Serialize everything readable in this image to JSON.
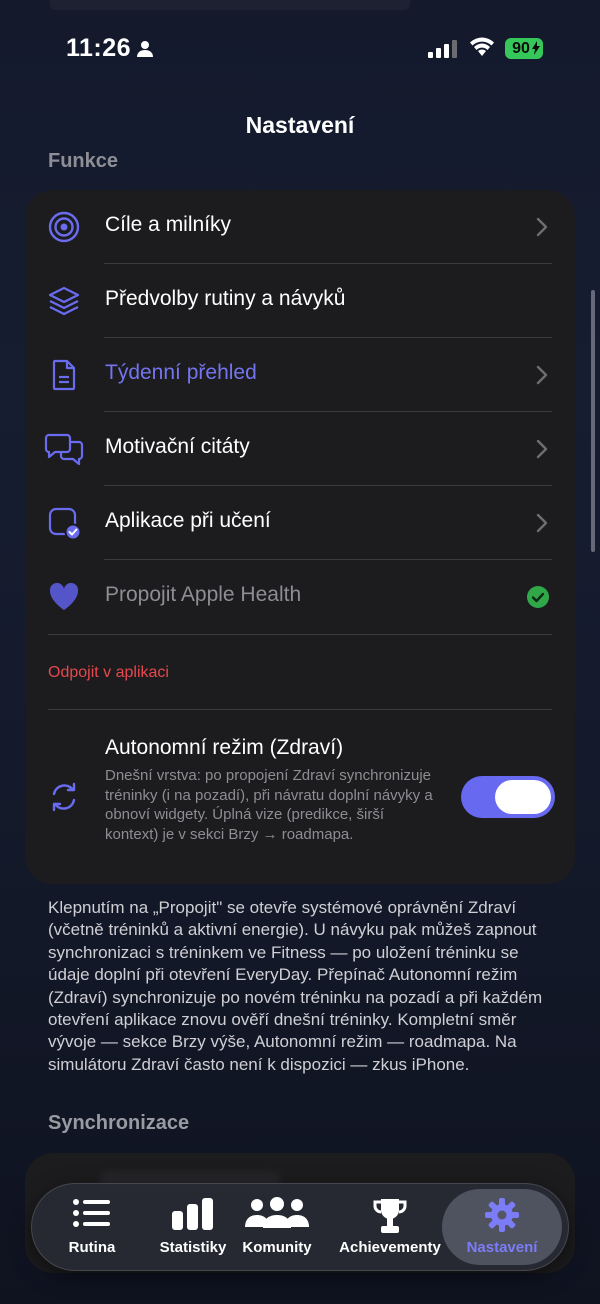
{
  "status_bar": {
    "time": "11:26",
    "battery": "90"
  },
  "nav": {
    "title": "Nastavení"
  },
  "sections": {
    "features_title": "Funkce",
    "sync_title": "Synchronizace"
  },
  "features": {
    "items": [
      {
        "label": "Cíle a milníky",
        "icon": "target-icon"
      },
      {
        "label": "Předvolby rutiny a návyků",
        "icon": "layers-icon"
      },
      {
        "label": "Týdenní přehled",
        "icon": "document-icon"
      },
      {
        "label": "Motivační citáty",
        "icon": "chat-bubbles-icon"
      },
      {
        "label": "Aplikace při učení",
        "icon": "app-check-icon"
      },
      {
        "label": "Propojit Apple Health",
        "icon": "heart-icon"
      }
    ],
    "disconnect_label": "Odpojit v aplikaci",
    "autonomous": {
      "title": "Autonomní režim (Zdraví)",
      "description": "Dnešní vrstva: po propojení Zdraví synchronizuje tréninky (i na pozadí), při návratu doplní návyky a obnoví widgety. Úplná vize (predikce, širší kontext) je v sekci Brzy → roadmapa.",
      "enabled": true
    }
  },
  "footer_text": "Klepnutím na „Propojit\" se otevře systémové oprávnění Zdraví (včetně tréninků a aktivní energie). U návyku pak můžeš zapnout synchronizaci s tréninkem ve Fitness — po uložení tréninku se údaje doplní při otevření EveryDay. Přepínač Autonomní režim (Zdraví) synchronizuje po novém tréninku na pozadí a při každém otevření aplikace znovu ověří dnešní tréninky. Kompletní směr vývoje — sekce Brzy výše, Autonomní režim — roadmapa. Na simulátoru Zdraví často není k dispozici — zkus iPhone.",
  "tabs": [
    {
      "label": "Rutina",
      "icon": "list-icon"
    },
    {
      "label": "Statistiky",
      "icon": "bar-chart-icon"
    },
    {
      "label": "Komunity",
      "icon": "people-icon"
    },
    {
      "label": "Achievementy",
      "icon": "trophy-icon"
    },
    {
      "label": "Nastavení",
      "icon": "gear-icon",
      "active": true
    }
  ],
  "colors": {
    "accent": "#6769f0",
    "danger": "#e5484d",
    "success": "#30a84a",
    "card": "#1c1c1e"
  }
}
